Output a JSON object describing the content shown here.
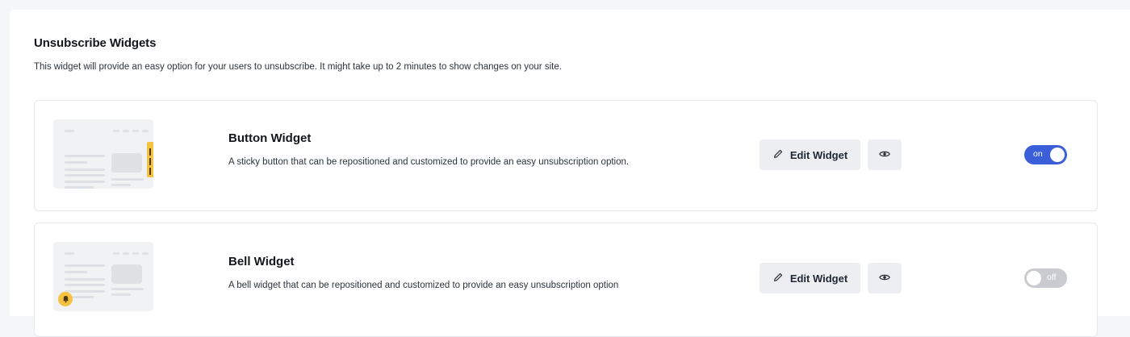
{
  "section": {
    "title": "Unsubscribe Widgets",
    "description": "This widget will provide an easy option for your users to unsubscribe. It might take up to 2 minutes to show changes on your site."
  },
  "widgets": [
    {
      "title": "Button Widget",
      "description": "A sticky button that can be repositioned and customized to provide an easy unsubscription option.",
      "edit_label": "Edit Widget",
      "preview_icon": "eye-icon",
      "toggle_label": "on",
      "enabled": true
    },
    {
      "title": "Bell Widget",
      "description": "A bell widget that can be repositioned and customized to provide an easy unsubscription option",
      "edit_label": "Edit Widget",
      "preview_icon": "eye-icon",
      "toggle_label": "off",
      "enabled": false
    }
  ],
  "colors": {
    "toggle_on": "#3a5fd9",
    "toggle_off": "#c9cbd0",
    "accent_yellow": "#f5c242"
  }
}
